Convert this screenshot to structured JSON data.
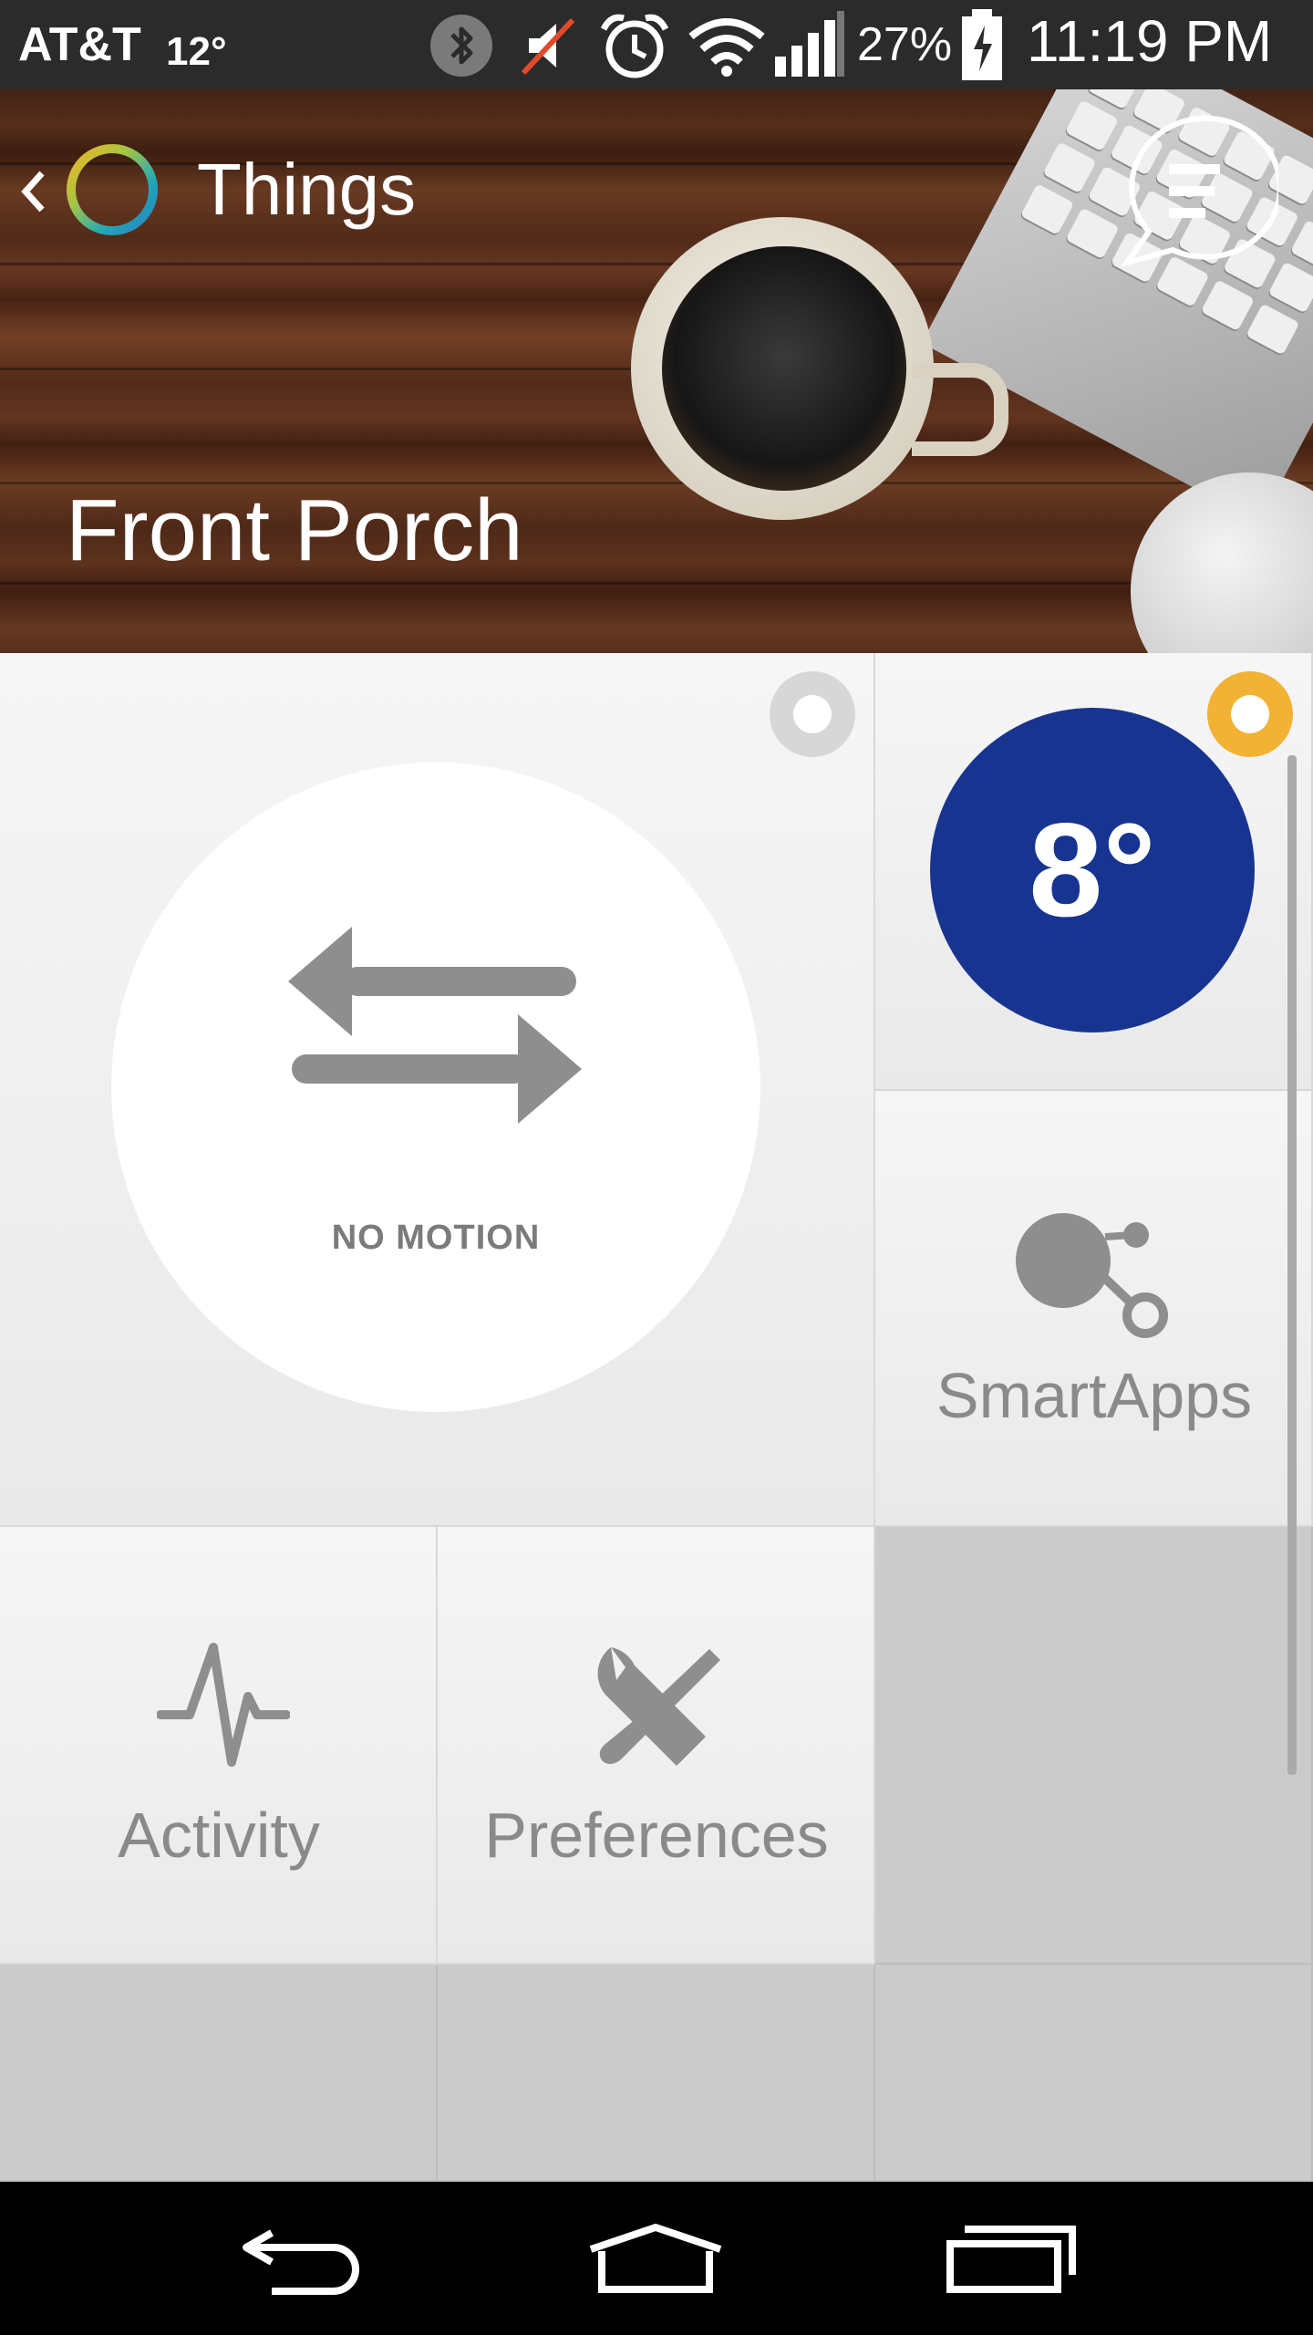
{
  "status_bar": {
    "carrier": "AT&T",
    "weather": "12°",
    "battery": "27%",
    "time": "11:19 PM"
  },
  "header": {
    "title": "Things",
    "location": "Front Porch"
  },
  "tiles": {
    "motion": {
      "status": "NO MOTION"
    },
    "temperature": {
      "value": "8°",
      "color": "#173590"
    },
    "smartapps": {
      "label": "SmartApps"
    },
    "activity": {
      "label": "Activity"
    },
    "preferences": {
      "label": "Preferences"
    }
  },
  "colors": {
    "accent_orange": "#f2b233",
    "temperature_blue": "#173590"
  }
}
